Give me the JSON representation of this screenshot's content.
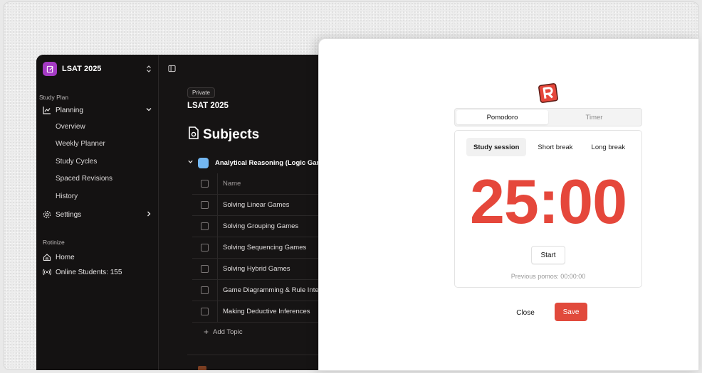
{
  "sidebar": {
    "workspace_name": "LSAT 2025",
    "study_plan_label": "Study Plan",
    "planning_label": "Planning",
    "planning_items": [
      "Overview",
      "Weekly Planner",
      "Study Cycles",
      "Spaced Revisions",
      "History"
    ],
    "settings_label": "Settings",
    "rotinize_label": "Rotinize",
    "home_label": "Home",
    "online_students": "Online Students: 155"
  },
  "main": {
    "badge": "Private",
    "project_title": "LSAT 2025",
    "page_title": "Subjects",
    "subject": "Analytical Reasoning (Logic Gam",
    "column_name": "Name",
    "topics": [
      "Solving Linear Games",
      "Solving Grouping Games",
      "Solving Sequencing Games",
      "Solving Hybrid Games",
      "Game Diagramming & Rule Inte",
      "Making Deductive Inferences"
    ],
    "add_topic": "Add Topic"
  },
  "modal": {
    "mode_tabs": [
      "Pomodoro",
      "Timer"
    ],
    "active_mode": "Pomodoro",
    "session_tabs": [
      "Study session",
      "Short break",
      "Long break"
    ],
    "active_session": "Study session",
    "time": "25:00",
    "start_label": "Start",
    "previous_pomos": "Previous pomos: 00:00:00",
    "close_label": "Close",
    "save_label": "Save"
  },
  "colors": {
    "accent_red": "#e14a3c",
    "timer_red": "#e5473b",
    "workspace_purple": "#a53bc4",
    "subject_blue": "#73b7f2"
  }
}
